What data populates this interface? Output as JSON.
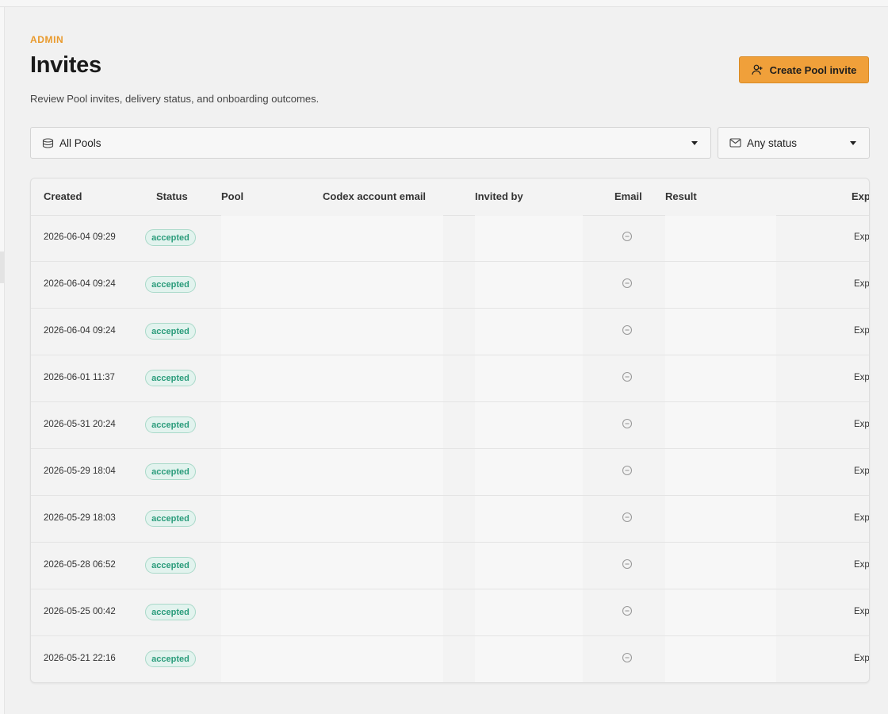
{
  "header": {
    "eyebrow": "ADMIN",
    "title": "Invites",
    "subtitle": "Review Pool invites, delivery status, and onboarding outcomes.",
    "create_button_label": "Create Pool invite"
  },
  "filters": {
    "pool_value": "All Pools",
    "status_value": "Any status"
  },
  "table": {
    "columns": {
      "created": "Created",
      "status": "Status",
      "pool": "Pool",
      "codex_email": "Codex account email",
      "invited_by": "Invited by",
      "email": "Email",
      "result": "Result",
      "expires": "Expi"
    },
    "rows": [
      {
        "created": "2026-06-04 09:29",
        "status": "accepted",
        "expires": "Expi"
      },
      {
        "created": "2026-06-04 09:24",
        "status": "accepted",
        "expires": "Expi"
      },
      {
        "created": "2026-06-04 09:24",
        "status": "accepted",
        "expires": "Expi"
      },
      {
        "created": "2026-06-01 11:37",
        "status": "accepted",
        "expires": "Expi"
      },
      {
        "created": "2026-05-31 20:24",
        "status": "accepted",
        "expires": "Expi"
      },
      {
        "created": "2026-05-29 18:04",
        "status": "accepted",
        "expires": "Expi"
      },
      {
        "created": "2026-05-29 18:03",
        "status": "accepted",
        "expires": "Expi"
      },
      {
        "created": "2026-05-28 06:52",
        "status": "accepted",
        "expires": "Expi"
      },
      {
        "created": "2026-05-25 00:42",
        "status": "accepted",
        "expires": "Expi"
      },
      {
        "created": "2026-05-21 22:16",
        "status": "accepted",
        "expires": "Expi"
      }
    ]
  },
  "icons": {
    "create_button": "user-plus-icon",
    "pool_filter": "database-icon",
    "status_filter": "mail-icon",
    "email_cell": "minus-circle-icon"
  },
  "colors": {
    "accent": "#f0a03a",
    "eyebrow": "#e99a2c",
    "badge_text": "#2a9c7b",
    "badge_bg": "#e2f3ee"
  }
}
